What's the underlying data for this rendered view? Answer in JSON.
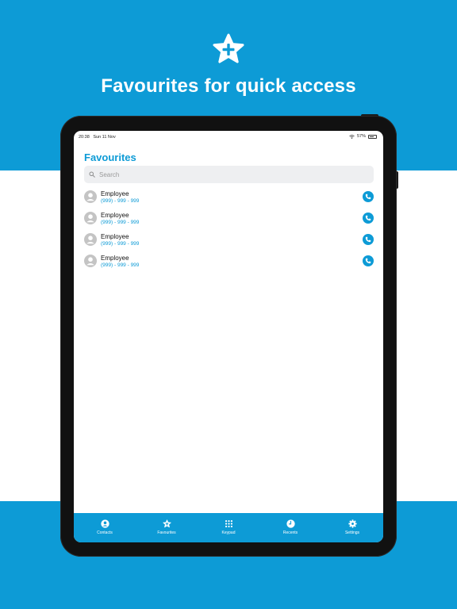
{
  "hero": {
    "icon": "star-plus-icon",
    "title": "Favourites for quick access"
  },
  "status_bar": {
    "time": "20:38",
    "date": "Sun 11 Nov",
    "battery": "57%"
  },
  "page": {
    "title": "Favourites"
  },
  "search": {
    "placeholder": "Search",
    "value": ""
  },
  "favourites": [
    {
      "name": "Employee",
      "phone": "(999) - 999 - 999"
    },
    {
      "name": "Employee",
      "phone": "(999) - 999 - 999"
    },
    {
      "name": "Employee",
      "phone": "(999) - 999 - 999"
    },
    {
      "name": "Employee",
      "phone": "(999) - 999 - 999"
    }
  ],
  "tabs": [
    {
      "label": "Contacts",
      "icon": "person-circle-icon"
    },
    {
      "label": "Favourites",
      "icon": "star-icon"
    },
    {
      "label": "Keypad",
      "icon": "keypad-icon"
    },
    {
      "label": "Recents",
      "icon": "clock-icon"
    },
    {
      "label": "Settings",
      "icon": "gear-icon"
    }
  ],
  "colors": {
    "accent": "#0d9bd6",
    "device_frame": "#111111",
    "search_bg": "#eeeff1",
    "avatar_gray": "#c4c4c4"
  }
}
